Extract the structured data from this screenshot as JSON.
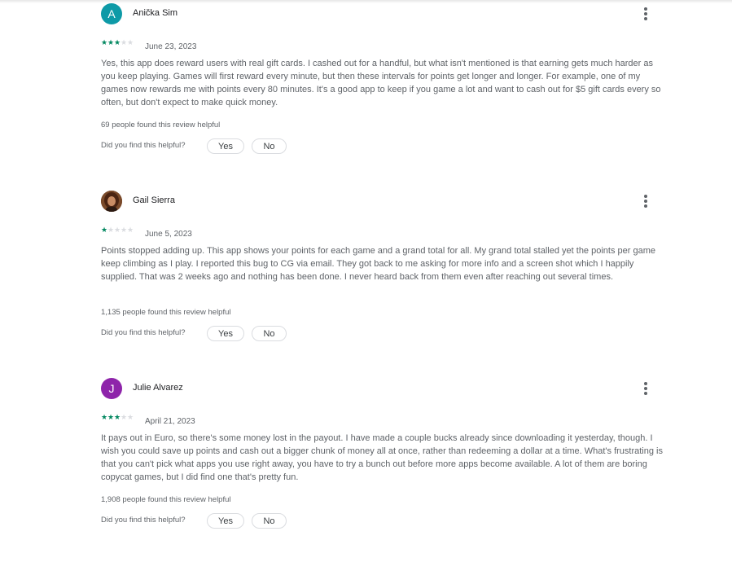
{
  "reviews": [
    {
      "author": "Anička Sim",
      "avatar_letter": "A",
      "avatar_color": "#0e9aa7",
      "rating": 3,
      "date": "June 23, 2023",
      "text": "Yes, this app does reward users with real gift cards. I cashed out for a handful, but what isn't mentioned is that earning gets much harder as you keep playing. Games will first reward every minute, but then these intervals for points get longer and longer. For example, one of my games now rewards me with points every 80 minutes. It's a good app to keep if you game a lot and want to cash out for $5 gift cards every so often, but don't expect to make quick money.",
      "helpful_count": "69 people found this review helpful",
      "helpful_question": "Did you find this helpful?",
      "yes_label": "Yes",
      "no_label": "No"
    },
    {
      "author": "Gail Sierra",
      "avatar_letter": "",
      "avatar_color": "#6b3a1f",
      "rating": 1,
      "date": "June 5, 2023",
      "text": "Points stopped adding up. This app shows your points for each game and a grand total for all. My grand total stalled yet the points per game keep climbing as I play. I reported this bug to CG via email. They got back to me asking for more info and a screen shot which I happily supplied. That was 2 weeks ago and nothing has been done. I never heard back from them even after reaching out several times.",
      "helpful_count": "1,135 people found this review helpful",
      "helpful_question": "Did you find this helpful?",
      "yes_label": "Yes",
      "no_label": "No"
    },
    {
      "author": "Julie Alvarez",
      "avatar_letter": "J",
      "avatar_color": "#8e24aa",
      "rating": 3,
      "date": "April 21, 2023",
      "text": "It pays out in Euro, so there's some money lost in the payout. I have made a couple bucks already since downloading it yesterday, though. I wish you could save up points and cash out a bigger chunk of money all at once, rather than redeeming a dollar at a time. What's frustrating is that you can't pick what apps you use right away, you have to try a bunch out before more apps become available. A lot of them are boring copycat games, but I did find one that's pretty fun.",
      "helpful_count": "1,908 people found this review helpful",
      "helpful_question": "Did you find this helpful?",
      "yes_label": "Yes",
      "no_label": "No"
    }
  ],
  "star_max": 5,
  "star_color_filled": "#01875f",
  "star_color_empty": "#dadce0"
}
